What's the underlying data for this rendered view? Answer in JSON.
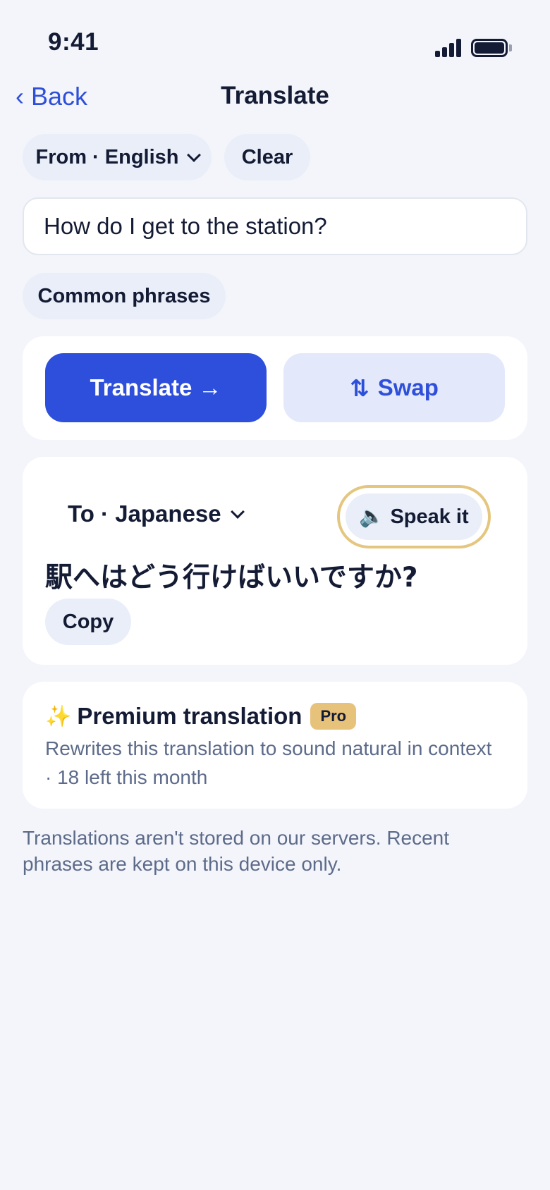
{
  "status": {
    "time": "9:41"
  },
  "nav": {
    "back_label": "Back",
    "title": "Translate"
  },
  "source": {
    "language_label": "From · English",
    "clear_label": "Clear",
    "input_value": "How do I get to the station?",
    "phrases_label": "Common phrases"
  },
  "actions": {
    "translate_label": "Translate →",
    "swap_icon": "⇅",
    "swap_label": "Swap"
  },
  "result": {
    "language_label": "To · Japanese",
    "speak_icon": "🔈",
    "speak_label": "Speak it",
    "translated_text": "駅へはどう行けばいいですか?",
    "copy_label": "Copy"
  },
  "premium": {
    "icon": "✨",
    "title": "Premium translation",
    "badge": "Pro",
    "description": "Rewrites this translation to sound natural in context · 18 left this month"
  },
  "footer": {
    "note": "Translations aren't stored on our servers. Recent phrases are kept on this device only."
  },
  "colors": {
    "accent": "#2e4fdc",
    "badge": "#e7c27a",
    "background": "#f3f5fa"
  }
}
